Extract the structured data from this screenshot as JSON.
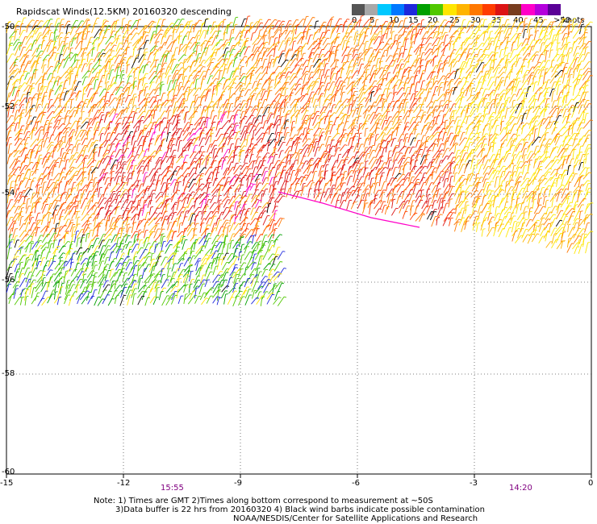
{
  "title": "Rapidscat Winds(12.5KM) 20160320 descending",
  "colorbar": {
    "colors": [
      "#555555",
      "#a8a8a8",
      "#00c8ff",
      "#0078ff",
      "#1e28dc",
      "#00a000",
      "#50c800",
      "#ffe600",
      "#ffb400",
      "#ff7800",
      "#ff3c00",
      "#dc1414",
      "#783c1e",
      "#ff00c8",
      "#b400dc",
      "#5a0096"
    ],
    "labels": [
      "0",
      "5",
      "10",
      "15",
      "20",
      "25",
      "30",
      "35",
      "40",
      "45",
      ">50"
    ],
    "units": "knots"
  },
  "axes": {
    "y_ticks": [
      "-50",
      "-52",
      "-54",
      "-56",
      "-58",
      "-60"
    ],
    "x_ticks": [
      "-15",
      "-12",
      "-9",
      "-6",
      "-3",
      "0"
    ]
  },
  "times": {
    "left": "15:55",
    "right": "14:20"
  },
  "notes": {
    "line1": "Note: 1) Times are GMT 2)Times along bottom correspond to measurement at ~50S",
    "line2": "3)Data buffer is 22 hrs from 20160320 4) Black wind barbs indicate possible contamination",
    "line3": "NOAA/NESDIS/Center for Satellite Applications and Research"
  }
}
